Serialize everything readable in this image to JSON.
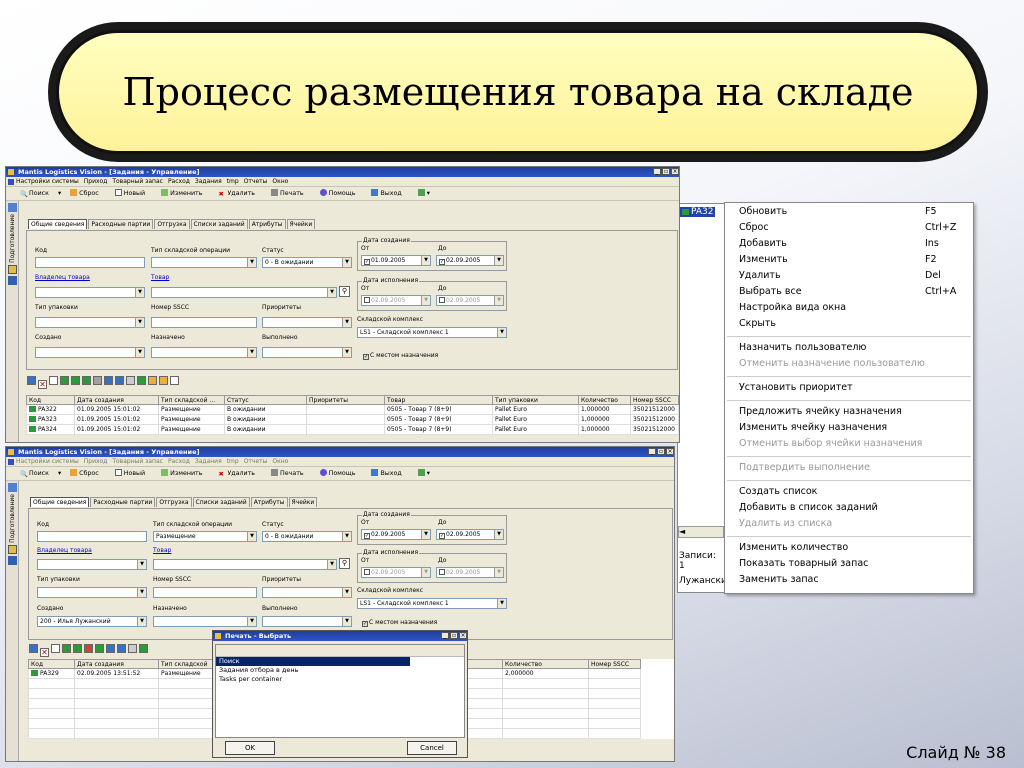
{
  "slide": {
    "title": "Процесс размещения товара на складе",
    "number": "Слайд № 38"
  },
  "app": {
    "title": "Mantis Logistics Vision - [Задания - Управление]",
    "menu": [
      "Настройки системы",
      "Приход",
      "Товарный запас",
      "Расход",
      "Задания",
      "tmp",
      "Отчеты",
      "Окно"
    ],
    "toolbar": [
      "Поиск",
      "Сброс",
      "Новый",
      "Изменить",
      "Удалить",
      "Печать",
      "Помощь",
      "Выход"
    ],
    "side_tab": "Подготовление",
    "tabs": [
      "Общие сведения",
      "Расходные партии",
      "Отгрузка",
      "Списки заданий",
      "Атрибуты",
      "Ячейки"
    ],
    "labels": {
      "code": "Код",
      "op_type": "Тип складской операции",
      "status": "Статус",
      "created_date": "Дата создания",
      "from": "От",
      "to": "До",
      "owner": "Владелец товара",
      "goods": "Товар",
      "exec_date": "Дата исполнения",
      "pack": "Тип упаковки",
      "sscc": "Номер SSCC",
      "priorities": "Приоритеты",
      "warehouse": "Складской комплекс",
      "created": "Создано",
      "assigned": "Назначено",
      "done": "Выполнено",
      "dest": "С местом назначения"
    },
    "status_value": "0 - В ожидании",
    "date_from": "01.09.2005",
    "date_to": "02.09.2005",
    "exec_from": "02.09.2005",
    "exec_to": "02.09.2005",
    "warehouse_value": "LS1 - Складской комплекс 1"
  },
  "win1": {
    "grid": {
      "columns": [
        "Код",
        "Дата создания",
        "Тип складской ...",
        "Статус",
        "Приоритеты",
        "Товар",
        "Тип упаковки",
        "Количество",
        "Номер SSCC"
      ],
      "rows": [
        [
          "PA322",
          "01.09.2005 15:01:02",
          "Размещение",
          "В ожидании",
          "",
          "0505 - Товар 7 (8+9)",
          "Pallet Euro",
          "1,000000",
          "35021512000"
        ],
        [
          "PA323",
          "01.09.2005 15:01:02",
          "Размещение",
          "В ожидании",
          "",
          "0505 - Товар 7 (8+9)",
          "Pallet Euro",
          "1,000000",
          "35021512000"
        ],
        [
          "PA324",
          "01.09.2005 15:01:02",
          "Размещение",
          "В ожидании",
          "",
          "0505 - Товар 7 (8+9)",
          "Pallet Euro",
          "1,000000",
          "35021512000"
        ]
      ]
    }
  },
  "win2": {
    "op_type_value": "Размещение",
    "created_value": "200 - Илья Лужанский",
    "grid": {
      "columns": [
        "Код",
        "Дата создания",
        "Тип складской",
        "Тип упаковки",
        "Количество",
        "Номер SSCC"
      ],
      "rows": [
        [
          "PA329",
          "02.09.2005 13:51:52",
          "Размещение",
          "Коробка(и)",
          "2,000000",
          ""
        ]
      ]
    }
  },
  "dialog": {
    "title": "Печать - Выбрать",
    "items": [
      "Поиск",
      "Задания отбора в день",
      "Tasks per container"
    ],
    "ok": "OK",
    "cancel": "Cancel"
  },
  "bgwin": {
    "cell": "PA32",
    "label1": "Записи: 1",
    "label2": "Лужански"
  },
  "context_menu": [
    {
      "label": "Обновить",
      "shortcut": "F5",
      "disabled": false
    },
    {
      "label": "Сброс",
      "shortcut": "Ctrl+Z",
      "disabled": false
    },
    {
      "label": "Добавить",
      "shortcut": "Ins",
      "disabled": false
    },
    {
      "label": "Изменить",
      "shortcut": "F2",
      "disabled": false
    },
    {
      "label": "Удалить",
      "shortcut": "Del",
      "disabled": false
    },
    {
      "label": "Выбрать все",
      "shortcut": "Ctrl+A",
      "disabled": false
    },
    {
      "label": "Настройка вида окна",
      "shortcut": "",
      "disabled": false
    },
    {
      "label": "Скрыть",
      "shortcut": "",
      "disabled": false
    },
    {
      "sep": true
    },
    {
      "label": "Назначить пользователю",
      "shortcut": "",
      "disabled": false
    },
    {
      "label": "Отменить назначение пользователю",
      "shortcut": "",
      "disabled": true
    },
    {
      "sep": true
    },
    {
      "label": "Установить приоритет",
      "shortcut": "",
      "disabled": false
    },
    {
      "sep": true
    },
    {
      "label": "Предложить ячейку назначения",
      "shortcut": "",
      "disabled": false
    },
    {
      "label": "Изменить ячейку назначения",
      "shortcut": "",
      "disabled": false
    },
    {
      "label": "Отменить выбор ячейки назначения",
      "shortcut": "",
      "disabled": true
    },
    {
      "sep": true
    },
    {
      "label": "Подтвердить выполнение",
      "shortcut": "",
      "disabled": true
    },
    {
      "sep": true
    },
    {
      "label": "Создать список",
      "shortcut": "",
      "disabled": false
    },
    {
      "label": "Добавить в список заданий",
      "shortcut": "",
      "disabled": false
    },
    {
      "label": "Удалить из списка",
      "shortcut": "",
      "disabled": true
    },
    {
      "sep": true
    },
    {
      "label": "Изменить количество",
      "shortcut": "",
      "disabled": false
    },
    {
      "label": "Показать товарный запас",
      "shortcut": "",
      "disabled": false
    },
    {
      "label": "Заменить запас",
      "shortcut": "",
      "disabled": false
    }
  ]
}
